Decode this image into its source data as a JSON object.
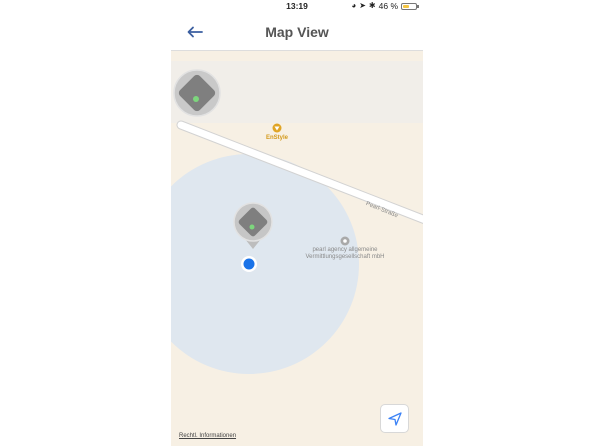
{
  "status_bar": {
    "time": "13:19",
    "battery_text": "46 %",
    "battery_level": 0.46
  },
  "header": {
    "title": "Map View",
    "back_icon": "arrow-left-icon"
  },
  "map": {
    "poi_business": "EnStyle",
    "street": "Pearl-Straße",
    "poi_company": "pearl agency allgemeine Vermittlungsgesellschaft mbH",
    "legal_link": "Rechtl. Informationen",
    "locate_icon": "location-arrow-icon",
    "colors": {
      "accuracy_circle": "#dde6ef",
      "user_dot": "#1a73e8",
      "business_poi": "#d49a1c",
      "back_arrow": "#3b5fa0"
    }
  }
}
